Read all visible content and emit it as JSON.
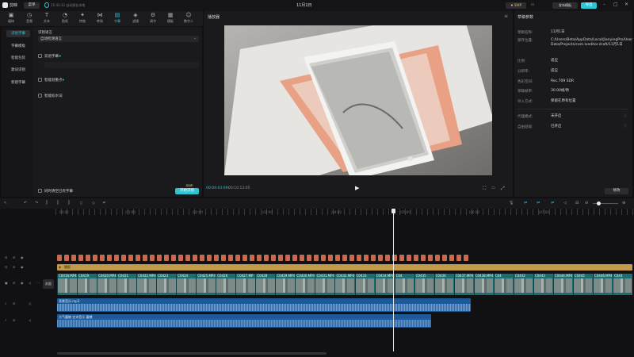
{
  "app": {
    "logo": "剪映",
    "menu_label": "菜单",
    "autosave": "15:43:33 自动保存本地",
    "title": "11月1日",
    "svip": "SVIP",
    "publish_label": "发布模板",
    "export_label": "导出"
  },
  "toolbar": {
    "tabs": [
      {
        "label": "媒体",
        "icon": "media-icon"
      },
      {
        "label": "音频",
        "icon": "audio-icon"
      },
      {
        "label": "文本",
        "icon": "text-icon"
      },
      {
        "label": "贴纸",
        "icon": "sticker-icon"
      },
      {
        "label": "特效",
        "icon": "effects-icon"
      },
      {
        "label": "转场",
        "icon": "transition-icon"
      },
      {
        "label": "字幕",
        "icon": "caption-icon"
      },
      {
        "label": "滤镜",
        "icon": "filter-icon"
      },
      {
        "label": "调节",
        "icon": "adjust-icon"
      },
      {
        "label": "模板",
        "icon": "template-icon"
      },
      {
        "label": "数字人",
        "icon": "avatar-icon"
      }
    ],
    "active_index": 6
  },
  "caption_panel": {
    "side_items": [
      "识别字幕",
      "字幕模板",
      "智能包装",
      "歌词识别",
      "新建字幕"
    ],
    "active_side": 0,
    "lang_label": "识别语言",
    "lang_value": "自动检测语言",
    "bilingual_label": "双语字幕",
    "keyword_label": "智能划重点",
    "filler_label": "智能标水词",
    "clear_label": "同时清空已有字幕",
    "start_label": "开始识别",
    "start_badge": "SVIP"
  },
  "player": {
    "title": "播放器",
    "current_time": "00:04:03:09",
    "total_time": "00:10:13:05"
  },
  "draft": {
    "title": "草稿参数",
    "props": [
      {
        "k": "草稿名称:",
        "v": "11月1日"
      },
      {
        "k": "保存位置:",
        "v": "C:/Users/Beta/AppData/Local/JianyingPro/User Data/Projects/com.lveditor.draft/11月1日"
      },
      {
        "k": "比例:",
        "v": "适应"
      },
      {
        "k": "分辨率:",
        "v": "适应"
      },
      {
        "k": "色彩空间:",
        "v": "Rec.709 SDR"
      },
      {
        "k": "草稿帧率:",
        "v": "30.00帧/秒"
      },
      {
        "k": "导入方式:",
        "v": "保留在原有位置"
      },
      {
        "k": "代理模式:",
        "v": "未开启"
      },
      {
        "k": "自由层级:",
        "v": "已开启"
      }
    ],
    "edit_label": "修改"
  },
  "timeline": {
    "ticks": [
      "00:00",
      "|01:00",
      "|02:00",
      "|03:00",
      "|04:00",
      "|05:00",
      "|06:00",
      "|07:00"
    ],
    "cover_label": "封面",
    "filter_track_label": "播报",
    "clips": [
      "C0418.MP4",
      "C0419.",
      "C0420.MP4",
      "C0421",
      "C0422.MP4",
      "C0423",
      "C0424",
      "C0425.MP4",
      "C0426",
      "C0427.MP",
      "C0428",
      "C0429.MP4",
      "C0430.MP4",
      "C0431.MP4",
      "C0432.MP4",
      "C0433",
      "C0434.MP4",
      "C04",
      "C0435",
      "C0436",
      "C0437.MP4",
      "C0438.MP4",
      "C04",
      "C0442",
      "C0443",
      "C0444.MP4",
      "C0445",
      "C0446.MP4",
      "C044"
    ],
    "audio1_label": "背景音乐.mp3",
    "audio2_label": "大气震撼 史诗音乐 震撼"
  }
}
